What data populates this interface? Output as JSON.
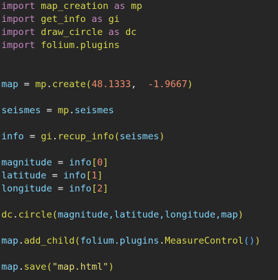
{
  "lines": {
    "l1": {
      "kw": "import",
      "mod": "map_creation",
      "as": "as",
      "alias": "mp"
    },
    "l2": {
      "kw": "import",
      "mod": "get_info",
      "as": "as",
      "alias": "gi"
    },
    "l3": {
      "kw": "import",
      "mod": "draw_circle",
      "as": "as",
      "alias": "dc"
    },
    "l4": {
      "kw": "import",
      "mod": "folium.plugins"
    },
    "l5": {
      "var": "map",
      "op": "=",
      "obj": "mp",
      "dot": ".",
      "fn": "create",
      "open": "(",
      "a1": "48.1333",
      "comma": ",",
      "a2": "-1.9667",
      "close": ")"
    },
    "l6": {
      "var": "seismes",
      "op": "=",
      "obj": "mp",
      "dot": ".",
      "attr": "seismes"
    },
    "l7": {
      "var": "info",
      "op": "=",
      "obj": "gi",
      "dot": ".",
      "fn": "recup_info",
      "open": "(",
      "arg": "seismes",
      "close": ")"
    },
    "l8": {
      "var": "magnitude",
      "op": "=",
      "obj": "info",
      "open": "[",
      "idx": "0",
      "close": "]"
    },
    "l9": {
      "var": "latitude",
      "op": "=",
      "obj": "info",
      "open": "[",
      "idx": "1",
      "close": "]"
    },
    "l10": {
      "var": "longitude",
      "op": "=",
      "obj": "info",
      "open": "[",
      "idx": "2",
      "close": "]"
    },
    "l11": {
      "obj": "dc",
      "dot": ".",
      "fn": "circle",
      "open": "(",
      "args": "magnitude,latitude,longitude,map",
      "close": ")"
    },
    "l12": {
      "obj": "map",
      "dot": ".",
      "fn": "add_child",
      "open": "(",
      "inner_obj": "folium.plugins",
      "dot2": ".",
      "inner_fn": "MeasureControl",
      "inner_parens": "()",
      "close": ")"
    },
    "l13": {
      "obj": "map",
      "dot": ".",
      "fn": "save",
      "open": "(",
      "str": "\"map.html\"",
      "close": ")"
    }
  },
  "colors": {
    "background": "#262626",
    "keyword": "#c586c0",
    "module": "#d7d74e",
    "variable": "#81d4fa",
    "number": "#f08d6b",
    "string": "#e6db74"
  }
}
